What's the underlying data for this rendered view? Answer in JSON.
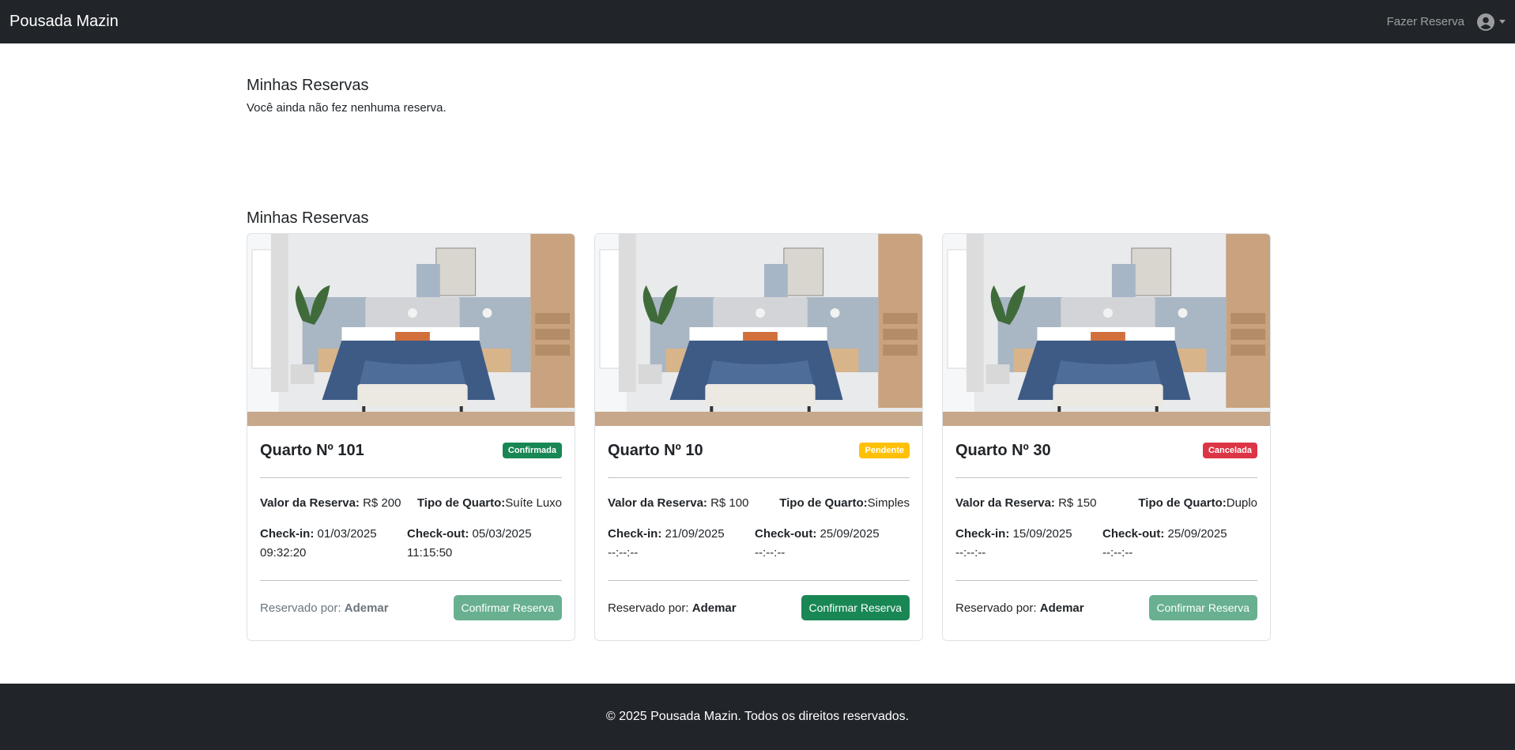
{
  "navbar": {
    "brand": "Pousada Mazin",
    "link": "Fazer Reserva",
    "user_icon": "user-circle-icon"
  },
  "top_section": {
    "title": "Minhas Reservas",
    "empty_message": "Você ainda não fez nenhuma reserva."
  },
  "bottom_section": {
    "title": "Minhas Reservas"
  },
  "labels": {
    "valor": "Valor da Reserva:",
    "tipo": "Tipo de Quarto:",
    "checkin": "Check-in:",
    "checkout": "Check-out:",
    "reservado_por": "Reservado por:",
    "confirm_button": "Confirmar Reserva"
  },
  "reservations": [
    {
      "title": "Quarto Nº 101",
      "status": "Confirmada",
      "status_color": "#198754",
      "valor": "R$ 200",
      "tipo": "Suíte Luxo",
      "checkin_date": "01/03/2025",
      "checkin_time": "09:32:20",
      "checkout_date": "05/03/2025",
      "checkout_time": "11:15:50",
      "reservado_por": "Ademar",
      "button_disabled": true
    },
    {
      "title": "Quarto Nº 10",
      "status": "Pendente",
      "status_color": "#ffc107",
      "valor": "R$ 100",
      "tipo": "Simples",
      "checkin_date": "21/09/2025",
      "checkin_time": "--:--:--",
      "checkout_date": "25/09/2025",
      "checkout_time": "--:--:--",
      "reservado_por": "Ademar",
      "button_disabled": false
    },
    {
      "title": "Quarto Nº 30",
      "status": "Cancelada",
      "status_color": "#dc3545",
      "valor": "R$ 150",
      "tipo": "Duplo",
      "checkin_date": "15/09/2025",
      "checkin_time": "--:--:--",
      "checkout_date": "25/09/2025",
      "checkout_time": "--:--:--",
      "reservado_por": "Ademar",
      "button_disabled": true
    }
  ],
  "footer": {
    "text": "© 2025 Pousada Mazin. Todos os direitos reservados."
  }
}
